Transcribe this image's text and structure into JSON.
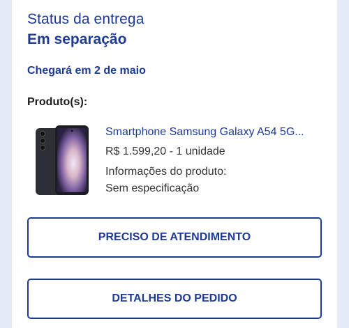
{
  "status": {
    "label": "Status da entrega",
    "value": "Em separação"
  },
  "delivery_estimate": "Chegará em 2 de maio",
  "products_title": "Produto(s):",
  "product": {
    "image_icon": "samsung-galaxy-phone-image",
    "name": "Smartphone Samsung Galaxy A54 5G...",
    "price_qty": "R$ 1.599,20 - 1 unidade",
    "info_label": "Informações do produto:",
    "info_value": "Sem especificação"
  },
  "buttons": {
    "support": "PRECISO DE ATENDIMENTO",
    "details": "DETALHES DO PEDIDO"
  },
  "colors": {
    "primary": "#1d3a94",
    "background": "#e4eaf7",
    "card": "#ffffff",
    "text": "#333333"
  }
}
